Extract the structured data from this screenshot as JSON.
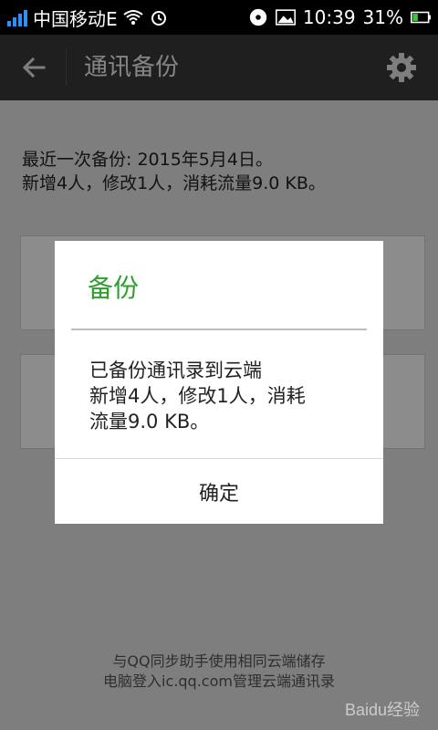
{
  "status_bar": {
    "carrier": "中国移动E",
    "time": "10:39",
    "battery": "31%"
  },
  "app_bar": {
    "title": "通讯备份"
  },
  "main": {
    "last_backup_line1": "最近一次备份: 2015年5月4日。",
    "last_backup_line2": "新增4人，修改1人，消耗流量9.0 KB。",
    "footer_line1": "与QQ同步助手使用相同云端储存",
    "footer_line2": "电脑登入ic.qq.com管理云端通讯录"
  },
  "dialog": {
    "title": "备份",
    "message_line1": "已备份通讯录到云端",
    "message_line2": "新增4人，修改1人，消耗",
    "message_line3": "流量9.0 KB。",
    "confirm_label": "确定"
  },
  "watermark": {
    "text": "Baidu经验"
  },
  "colors": {
    "accent_green": "#2e9e2e",
    "signal_blue": "#2f8fff",
    "battery_green": "#3fc43f"
  }
}
